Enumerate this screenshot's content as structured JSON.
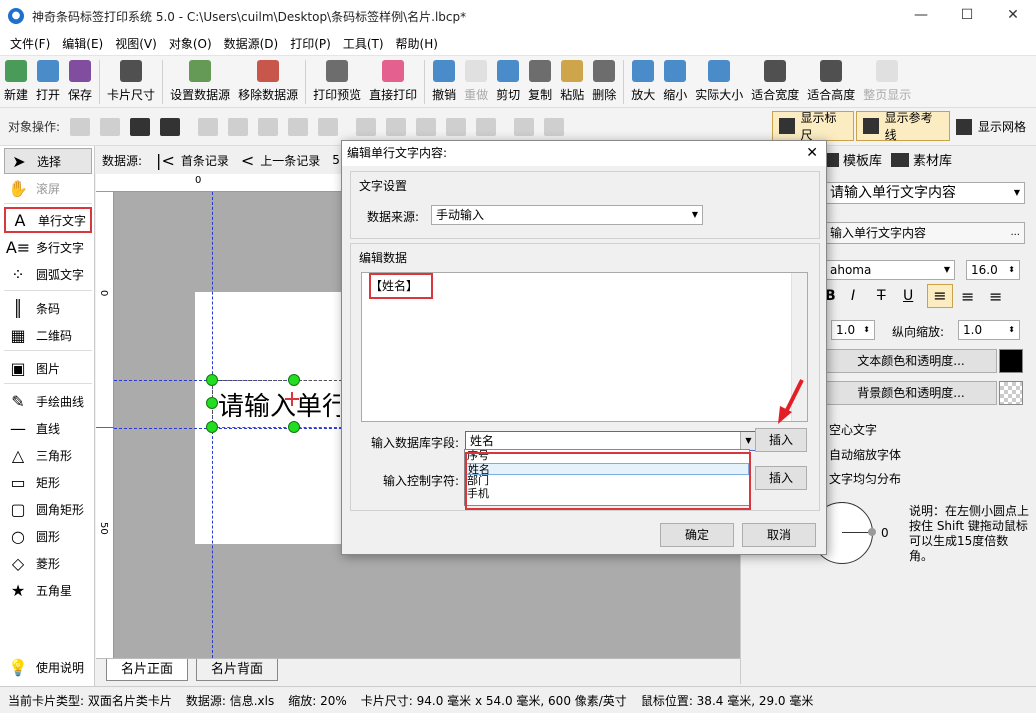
{
  "app": {
    "title": "神奇条码标签打印系统 5.0 - C:\\Users\\cuilm\\Desktop\\条码标签样例\\名片.lbcp*",
    "icon": "app-logo-icon"
  },
  "menu": [
    "文件(F)",
    "编辑(E)",
    "视图(V)",
    "对象(O)",
    "数据源(D)",
    "打印(P)",
    "工具(T)",
    "帮助(H)"
  ],
  "toolbar": [
    {
      "label": "新建",
      "icon": "new-file-icon",
      "color": "#2c8a3d"
    },
    {
      "label": "打开",
      "icon": "open-icon",
      "color": "#2b78c2"
    },
    {
      "label": "保存",
      "icon": "save-icon",
      "color": "#6b2f8f"
    },
    {
      "label": "卡片尺寸",
      "icon": "card-size-icon",
      "color": "#333333"
    },
    {
      "label": "设置数据源",
      "icon": "database-settings-icon",
      "color": "#4a8a3a"
    },
    {
      "label": "移除数据源",
      "icon": "database-remove-icon",
      "color": "#c0392b"
    },
    {
      "label": "打印预览",
      "icon": "print-preview-icon",
      "color": "#555555"
    },
    {
      "label": "直接打印",
      "icon": "print-icon",
      "color": "#e0457b"
    },
    {
      "label": "撤销",
      "icon": "undo-icon",
      "color": "#2b78c2"
    },
    {
      "label": "重做",
      "icon": "redo-icon",
      "color": "#bbbbbb",
      "disabled": true
    },
    {
      "label": "剪切",
      "icon": "cut-icon",
      "color": "#2b78c2"
    },
    {
      "label": "复制",
      "icon": "copy-icon",
      "color": "#555555"
    },
    {
      "label": "粘贴",
      "icon": "paste-icon",
      "color": "#c8962e"
    },
    {
      "label": "删除",
      "icon": "delete-icon",
      "color": "#555555"
    },
    {
      "label": "放大",
      "icon": "zoom-in-icon",
      "color": "#2b78c2"
    },
    {
      "label": "缩小",
      "icon": "zoom-out-icon",
      "color": "#2b78c2"
    },
    {
      "label": "实际大小",
      "icon": "actual-size-icon",
      "color": "#2b78c2"
    },
    {
      "label": "适合宽度",
      "icon": "fit-width-icon",
      "color": "#333333"
    },
    {
      "label": "适合高度",
      "icon": "fit-height-icon",
      "color": "#333333"
    },
    {
      "label": "整页显示",
      "icon": "fit-page-icon",
      "color": "#bbbbbb",
      "disabled": true
    }
  ],
  "objbar": {
    "label": "对象操作:",
    "show_ruler": "显示标尺",
    "show_guides": "显示参考线",
    "show_grid": "显示网格"
  },
  "left_tools": [
    {
      "label": "选择",
      "icon": "pointer-icon",
      "selected": true
    },
    {
      "label": "滚屏",
      "icon": "hand-icon",
      "disabled": true
    },
    {
      "label": "单行文字",
      "icon": "single-line-text-icon",
      "highlight": true
    },
    {
      "label": "多行文字",
      "icon": "multi-line-text-icon"
    },
    {
      "label": "圆弧文字",
      "icon": "arc-text-icon"
    },
    {
      "label": "条码",
      "icon": "barcode-icon"
    },
    {
      "label": "二维码",
      "icon": "qrcode-icon"
    },
    {
      "label": "图片",
      "icon": "image-icon"
    },
    {
      "label": "手绘曲线",
      "icon": "freehand-icon"
    },
    {
      "label": "直线",
      "icon": "line-icon"
    },
    {
      "label": "三角形",
      "icon": "triangle-icon"
    },
    {
      "label": "矩形",
      "icon": "rectangle-icon"
    },
    {
      "label": "圆角矩形",
      "icon": "rounded-rectangle-icon"
    },
    {
      "label": "圆形",
      "icon": "circle-icon"
    },
    {
      "label": "菱形",
      "icon": "diamond-icon"
    },
    {
      "label": "五角星",
      "icon": "star-icon"
    },
    {
      "label": "使用说明",
      "icon": "lightbulb-icon"
    }
  ],
  "nav": {
    "datasource_label": "数据源:",
    "first_record": "首条记录",
    "prev_record": "上一条记录",
    "record_no": "5"
  },
  "ruler": {
    "h0": "0",
    "v0": "0",
    "v50": "50"
  },
  "canvas": {
    "text": "请输入单行"
  },
  "tabs": [
    "名片正面",
    "名片背面"
  ],
  "right": {
    "tab_templates": "模板库",
    "tab_assets": "素材库",
    "text_combo": "请输入单行文字内容",
    "text_input": "输入单行文字内容",
    "font": "ahoma",
    "font_size": "16.0",
    "scale_a": "1.0",
    "scale_label": "纵向缩放:",
    "scale_b": "1.0",
    "text_color_btn": "文本颜色和透明度...",
    "bg_color_btn": "背景颜色和透明度...",
    "text_color": "#000000",
    "chk_hollow": "空心文字",
    "chk_autoscale": "自动缩放字体",
    "chk_distribute": "文字均匀分布",
    "angle_value": "0",
    "hint": "说明：在左侧小圆点上按住 Shift 键拖动鼠标可以生成15度倍数角。"
  },
  "status": {
    "card_type": "当前卡片类型: 双面名片类卡片",
    "datasource": "数据源: 信息.xls",
    "zoom": "缩放: 20%",
    "card_size": "卡片尺寸: 94.0 毫米 x 54.0 毫米, 600 像素/英寸",
    "mouse_pos": "鼠标位置: 38.4 毫米, 29.0 毫米"
  },
  "dialog": {
    "title": "编辑单行文字内容:",
    "text_settings": "文字设置",
    "source_label": "数据来源:",
    "source_value": "手动输入",
    "edit_data": "编辑数据",
    "edit_content": "【姓名】",
    "db_field_label": "输入数据库字段:",
    "db_field_value": "姓名",
    "insert": "插入",
    "control_char_label": "输入控制字符:",
    "dropdown_options": [
      "序号",
      "姓名",
      "部门",
      "手机"
    ],
    "selected_option_index": 1,
    "ok": "确定",
    "cancel": "取消"
  }
}
